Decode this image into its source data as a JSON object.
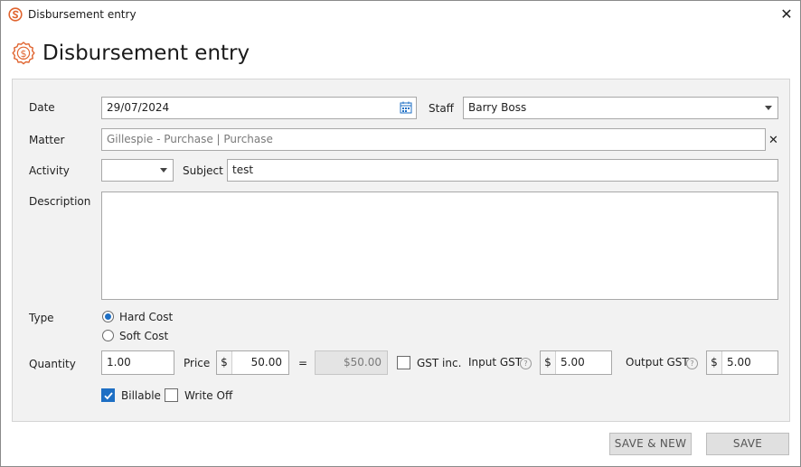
{
  "window": {
    "title": "Disbursement entry",
    "close_glyph": "✕"
  },
  "header": {
    "title": "Disbursement entry"
  },
  "form": {
    "date_label": "Date",
    "date_value": "29/07/2024",
    "staff_label": "Staff",
    "staff_value": "Barry Boss",
    "matter_label": "Matter",
    "matter_value": "Gillespie - Purchase | Purchase",
    "matter_clear_glyph": "✕",
    "activity_label": "Activity",
    "activity_value": "",
    "subject_label": "Subject",
    "subject_value": "test",
    "description_label": "Description",
    "description_value": "",
    "type_label": "Type",
    "type_options": [
      "Hard Cost",
      "Soft Cost"
    ],
    "type_selected": "Hard Cost",
    "quantity_label": "Quantity",
    "quantity_value": "1.00",
    "price_label": "Price",
    "currency_symbol": "$",
    "price_value": "50.00",
    "equals_sign": "=",
    "total_value": "$50.00",
    "gst_inc_label": "GST inc.",
    "gst_inc_checked": false,
    "input_gst_label": "Input GST",
    "input_gst_value": "5.00",
    "output_gst_label": "Output GST",
    "output_gst_value": "5.00",
    "help_glyph": "?",
    "billable_label": "Billable",
    "billable_checked": true,
    "write_off_label": "Write Off",
    "write_off_checked": false
  },
  "footer": {
    "save_new_label": "SAVE & NEW",
    "save_label": "SAVE"
  },
  "colors": {
    "accent": "#1e6fc4",
    "brand": "#e0642f",
    "panel_bg": "#f2f2f2"
  },
  "icons": {
    "app": "app-logo-icon",
    "header": "dollar-badge-icon",
    "calendar": "calendar-icon",
    "dropdown": "chevron-down-icon",
    "help": "help-circle-icon"
  }
}
